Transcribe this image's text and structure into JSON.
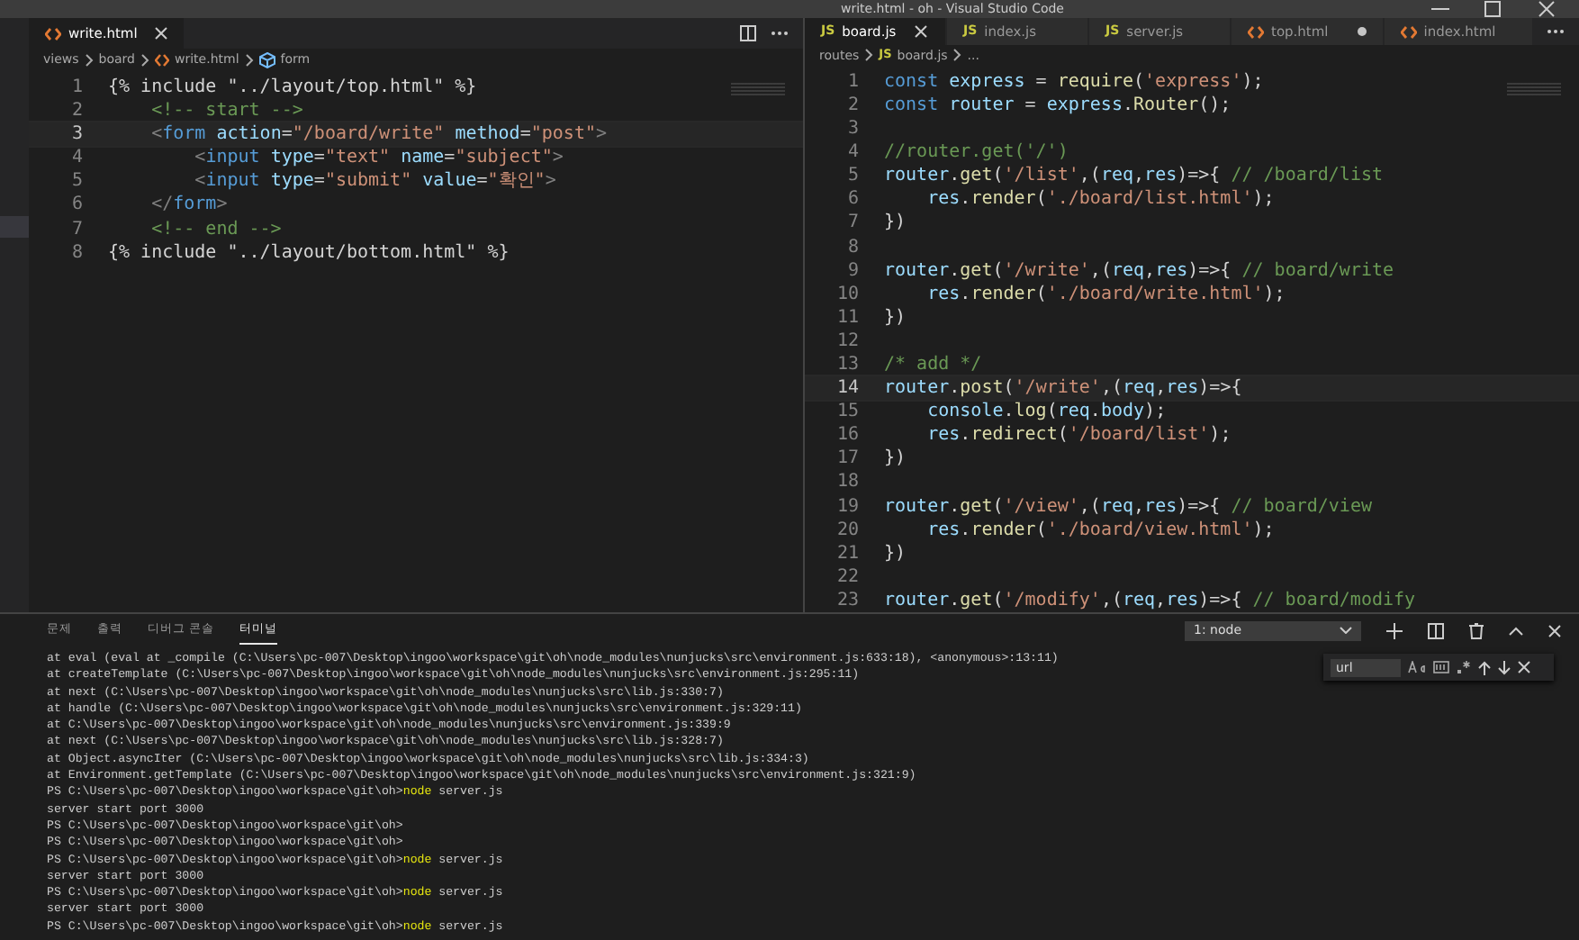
{
  "window": {
    "title": "write.html - oh - Visual Studio Code"
  },
  "left_editor": {
    "tabs": [
      {
        "label": "write.html",
        "kind": "markup",
        "selected": true,
        "modified": false
      }
    ],
    "breadcrumbs": [
      {
        "label": "views",
        "kind": "folder"
      },
      {
        "label": "board",
        "kind": "folder"
      },
      {
        "label": "write.html",
        "kind": "markup"
      },
      {
        "label": "form",
        "kind": "element"
      }
    ],
    "lines": [
      {
        "number": "1",
        "current": false,
        "tokens": [
          {
            "kind": "plain",
            "text": "{% include \"../layout/top.html\" %}"
          }
        ]
      },
      {
        "number": "2",
        "current": false,
        "tokens": [
          {
            "kind": "comment",
            "text": "    <!-- start -->"
          }
        ]
      },
      {
        "number": "3",
        "current": true,
        "tokens": [
          {
            "kind": "punc",
            "text": "    <"
          },
          {
            "kind": "tag",
            "text": "form"
          },
          {
            "kind": "attr",
            "text": " action"
          },
          {
            "kind": "plain",
            "text": "="
          },
          {
            "kind": "string",
            "text": "\"/board/write\""
          },
          {
            "kind": "attr",
            "text": " method"
          },
          {
            "kind": "plain",
            "text": "="
          },
          {
            "kind": "string",
            "text": "\"post\""
          },
          {
            "kind": "punc",
            "text": ">"
          }
        ]
      },
      {
        "number": "4",
        "current": false,
        "tokens": [
          {
            "kind": "punc",
            "text": "        <"
          },
          {
            "kind": "tag",
            "text": "input"
          },
          {
            "kind": "attr",
            "text": " type"
          },
          {
            "kind": "plain",
            "text": "="
          },
          {
            "kind": "string",
            "text": "\"text\""
          },
          {
            "kind": "attr",
            "text": " name"
          },
          {
            "kind": "plain",
            "text": "="
          },
          {
            "kind": "string",
            "text": "\"subject\""
          },
          {
            "kind": "punc",
            "text": ">"
          }
        ]
      },
      {
        "number": "5",
        "current": false,
        "tokens": [
          {
            "kind": "punc",
            "text": "        <"
          },
          {
            "kind": "tag",
            "text": "input"
          },
          {
            "kind": "attr",
            "text": " type"
          },
          {
            "kind": "plain",
            "text": "="
          },
          {
            "kind": "string",
            "text": "\"submit\""
          },
          {
            "kind": "attr",
            "text": " value"
          },
          {
            "kind": "plain",
            "text": "="
          },
          {
            "kind": "string",
            "text": "\"확인\""
          },
          {
            "kind": "punc",
            "text": ">"
          }
        ]
      },
      {
        "number": "6",
        "current": false,
        "tokens": [
          {
            "kind": "punc",
            "text": "    </"
          },
          {
            "kind": "tag",
            "text": "form"
          },
          {
            "kind": "punc",
            "text": ">"
          }
        ]
      },
      {
        "number": "7",
        "current": false,
        "tokens": [
          {
            "kind": "comment",
            "text": "    <!-- end -->"
          }
        ]
      },
      {
        "number": "8",
        "current": false,
        "tokens": [
          {
            "kind": "plain",
            "text": "{% include \"../layout/bottom.html\" %}"
          }
        ]
      }
    ]
  },
  "right_editor": {
    "tabs": [
      {
        "label": "board.js",
        "kind": "script",
        "badge": "JS",
        "selected": true,
        "modified": false
      },
      {
        "label": "index.js",
        "kind": "script",
        "badge": "JS",
        "selected": false,
        "modified": false
      },
      {
        "label": "server.js",
        "kind": "script",
        "badge": "JS",
        "selected": false,
        "modified": false
      },
      {
        "label": "top.html",
        "kind": "markup",
        "selected": false,
        "modified": true
      },
      {
        "label": "index.html",
        "kind": "markup",
        "selected": false,
        "modified": false
      }
    ],
    "breadcrumbs": [
      {
        "label": "routes",
        "kind": "folder"
      },
      {
        "label": "board.js",
        "kind": "script",
        "badge": "JS"
      },
      {
        "label": "...",
        "kind": "folder"
      }
    ],
    "lines": [
      {
        "number": "1",
        "current": false,
        "tokens": [
          {
            "kind": "keyword",
            "text": "const"
          },
          {
            "kind": "var",
            "text": " express"
          },
          {
            "kind": "plain",
            "text": " = "
          },
          {
            "kind": "func",
            "text": "require"
          },
          {
            "kind": "plain",
            "text": "("
          },
          {
            "kind": "string",
            "text": "'express'"
          },
          {
            "kind": "plain",
            "text": ");"
          }
        ]
      },
      {
        "number": "2",
        "current": false,
        "tokens": [
          {
            "kind": "keyword",
            "text": "const"
          },
          {
            "kind": "var",
            "text": " router"
          },
          {
            "kind": "plain",
            "text": " = "
          },
          {
            "kind": "var",
            "text": "express"
          },
          {
            "kind": "plain",
            "text": "."
          },
          {
            "kind": "func",
            "text": "Router"
          },
          {
            "kind": "plain",
            "text": "();"
          }
        ]
      },
      {
        "number": "3",
        "current": false
      },
      {
        "number": "4",
        "current": false,
        "tokens": [
          {
            "kind": "comment",
            "text": "//router.get('/')"
          }
        ]
      },
      {
        "number": "5",
        "current": false,
        "tokens": [
          {
            "kind": "var",
            "text": "router"
          },
          {
            "kind": "plain",
            "text": "."
          },
          {
            "kind": "func",
            "text": "get"
          },
          {
            "kind": "plain",
            "text": "("
          },
          {
            "kind": "string",
            "text": "'/list'"
          },
          {
            "kind": "plain",
            "text": ",("
          },
          {
            "kind": "var",
            "text": "req"
          },
          {
            "kind": "plain",
            "text": ","
          },
          {
            "kind": "var",
            "text": "res"
          },
          {
            "kind": "plain",
            "text": ")=>{ "
          },
          {
            "kind": "comment",
            "text": "// /board/list"
          }
        ]
      },
      {
        "number": "6",
        "current": false,
        "tokens": [
          {
            "kind": "var",
            "text": "    res"
          },
          {
            "kind": "plain",
            "text": "."
          },
          {
            "kind": "func",
            "text": "render"
          },
          {
            "kind": "plain",
            "text": "("
          },
          {
            "kind": "string",
            "text": "'./board/list.html'"
          },
          {
            "kind": "plain",
            "text": ");"
          }
        ]
      },
      {
        "number": "7",
        "current": false,
        "tokens": [
          {
            "kind": "plain",
            "text": "})"
          }
        ]
      },
      {
        "number": "8",
        "current": false
      },
      {
        "number": "9",
        "current": false,
        "tokens": [
          {
            "kind": "var",
            "text": "router"
          },
          {
            "kind": "plain",
            "text": "."
          },
          {
            "kind": "func",
            "text": "get"
          },
          {
            "kind": "plain",
            "text": "("
          },
          {
            "kind": "string",
            "text": "'/write'"
          },
          {
            "kind": "plain",
            "text": ",("
          },
          {
            "kind": "var",
            "text": "req"
          },
          {
            "kind": "plain",
            "text": ","
          },
          {
            "kind": "var",
            "text": "res"
          },
          {
            "kind": "plain",
            "text": ")=>{ "
          },
          {
            "kind": "comment",
            "text": "// board/write"
          }
        ]
      },
      {
        "number": "10",
        "current": false,
        "tokens": [
          {
            "kind": "var",
            "text": "    res"
          },
          {
            "kind": "plain",
            "text": "."
          },
          {
            "kind": "func",
            "text": "render"
          },
          {
            "kind": "plain",
            "text": "("
          },
          {
            "kind": "string",
            "text": "'./board/write.html'"
          },
          {
            "kind": "plain",
            "text": ");"
          }
        ]
      },
      {
        "number": "11",
        "current": false,
        "tokens": [
          {
            "kind": "plain",
            "text": "})"
          }
        ]
      },
      {
        "number": "12",
        "current": false
      },
      {
        "number": "13",
        "current": false,
        "tokens": [
          {
            "kind": "comment",
            "text": "/* add */"
          }
        ]
      },
      {
        "number": "14",
        "current": true,
        "tokens": [
          {
            "kind": "var",
            "text": "router"
          },
          {
            "kind": "plain",
            "text": "."
          },
          {
            "kind": "func",
            "text": "post"
          },
          {
            "kind": "plain",
            "text": "("
          },
          {
            "kind": "string",
            "text": "'/write'"
          },
          {
            "kind": "plain",
            "text": ",("
          },
          {
            "kind": "var",
            "text": "req"
          },
          {
            "kind": "plain",
            "text": ","
          },
          {
            "kind": "var",
            "text": "res"
          },
          {
            "kind": "plain",
            "text": ")=>{"
          }
        ]
      },
      {
        "number": "15",
        "current": false,
        "tokens": [
          {
            "kind": "var",
            "text": "    console"
          },
          {
            "kind": "plain",
            "text": "."
          },
          {
            "kind": "func",
            "text": "log"
          },
          {
            "kind": "plain",
            "text": "("
          },
          {
            "kind": "var",
            "text": "req"
          },
          {
            "kind": "plain",
            "text": "."
          },
          {
            "kind": "var",
            "text": "body"
          },
          {
            "kind": "plain",
            "text": ");"
          }
        ]
      },
      {
        "number": "16",
        "current": false,
        "tokens": [
          {
            "kind": "var",
            "text": "    res"
          },
          {
            "kind": "plain",
            "text": "."
          },
          {
            "kind": "func",
            "text": "redirect"
          },
          {
            "kind": "plain",
            "text": "("
          },
          {
            "kind": "string",
            "text": "'/board/list'"
          },
          {
            "kind": "plain",
            "text": ");"
          }
        ]
      },
      {
        "number": "17",
        "current": false,
        "tokens": [
          {
            "kind": "plain",
            "text": "})"
          }
        ]
      },
      {
        "number": "18",
        "current": false
      },
      {
        "number": "19",
        "current": false,
        "tokens": [
          {
            "kind": "var",
            "text": "router"
          },
          {
            "kind": "plain",
            "text": "."
          },
          {
            "kind": "func",
            "text": "get"
          },
          {
            "kind": "plain",
            "text": "("
          },
          {
            "kind": "string",
            "text": "'/view'"
          },
          {
            "kind": "plain",
            "text": ",("
          },
          {
            "kind": "var",
            "text": "req"
          },
          {
            "kind": "plain",
            "text": ","
          },
          {
            "kind": "var",
            "text": "res"
          },
          {
            "kind": "plain",
            "text": ")=>{ "
          },
          {
            "kind": "comment",
            "text": "// board/view"
          }
        ]
      },
      {
        "number": "20",
        "current": false,
        "tokens": [
          {
            "kind": "var",
            "text": "    res"
          },
          {
            "kind": "plain",
            "text": "."
          },
          {
            "kind": "func",
            "text": "render"
          },
          {
            "kind": "plain",
            "text": "("
          },
          {
            "kind": "string",
            "text": "'./board/view.html'"
          },
          {
            "kind": "plain",
            "text": ");"
          }
        ]
      },
      {
        "number": "21",
        "current": false,
        "tokens": [
          {
            "kind": "plain",
            "text": "})"
          }
        ]
      },
      {
        "number": "22",
        "current": false
      },
      {
        "number": "23",
        "current": false,
        "tokens": [
          {
            "kind": "var",
            "text": "router"
          },
          {
            "kind": "plain",
            "text": "."
          },
          {
            "kind": "func",
            "text": "get"
          },
          {
            "kind": "plain",
            "text": "("
          },
          {
            "kind": "string",
            "text": "'/modify'"
          },
          {
            "kind": "plain",
            "text": ",("
          },
          {
            "kind": "var",
            "text": "req"
          },
          {
            "kind": "plain",
            "text": ","
          },
          {
            "kind": "var",
            "text": "res"
          },
          {
            "kind": "plain",
            "text": ")=>{ "
          },
          {
            "kind": "comment",
            "text": "// board/modify"
          }
        ]
      }
    ]
  },
  "panel": {
    "tabs": [
      {
        "label": "문제",
        "selected": false
      },
      {
        "label": "출력",
        "selected": false
      },
      {
        "label": "디버그 콘솔",
        "selected": false
      },
      {
        "label": "터미널",
        "selected": true
      }
    ],
    "terminal_select": {
      "value": "1: node"
    },
    "find": {
      "value": "url"
    },
    "terminal_lines": [
      {
        "kind": "trace",
        "text": "at eval (eval at _compile (C:\\Users\\pc-007\\Desktop\\ingoo\\workspace\\git\\oh\\node_modules\\nunjucks\\src\\environment.js:633:18), <anonymous>:13:11)"
      },
      {
        "kind": "trace",
        "text": "at createTemplate (C:\\Users\\pc-007\\Desktop\\ingoo\\workspace\\git\\oh\\node_modules\\nunjucks\\src\\environment.js:295:11)"
      },
      {
        "kind": "trace",
        "text": "at next (C:\\Users\\pc-007\\Desktop\\ingoo\\workspace\\git\\oh\\node_modules\\nunjucks\\src\\lib.js:330:7)"
      },
      {
        "kind": "trace",
        "text": "at handle (C:\\Users\\pc-007\\Desktop\\ingoo\\workspace\\git\\oh\\node_modules\\nunjucks\\src\\environment.js:329:11)"
      },
      {
        "kind": "trace",
        "text": "at C:\\Users\\pc-007\\Desktop\\ingoo\\workspace\\git\\oh\\node_modules\\nunjucks\\src\\environment.js:339:9"
      },
      {
        "kind": "trace",
        "text": "at next (C:\\Users\\pc-007\\Desktop\\ingoo\\workspace\\git\\oh\\node_modules\\nunjucks\\src\\lib.js:328:7)"
      },
      {
        "kind": "trace",
        "text": "at Object.asyncIter (C:\\Users\\pc-007\\Desktop\\ingoo\\workspace\\git\\oh\\node_modules\\nunjucks\\src\\lib.js:334:3)"
      },
      {
        "kind": "trace",
        "text": "at Environment.getTemplate (C:\\Users\\pc-007\\Desktop\\ingoo\\workspace\\git\\oh\\node_modules\\nunjucks\\src\\environment.js:321:9)"
      },
      {
        "kind": "prompt",
        "text": "PS C:\\Users\\pc-007\\Desktop\\ingoo\\workspace\\git\\oh>",
        "command": "node",
        "args": "server.js"
      },
      {
        "kind": "output",
        "text": "server start port 3000"
      },
      {
        "kind": "prompt",
        "text": "PS C:\\Users\\pc-007\\Desktop\\ingoo\\workspace\\git\\oh>"
      },
      {
        "kind": "prompt",
        "text": "PS C:\\Users\\pc-007\\Desktop\\ingoo\\workspace\\git\\oh>"
      },
      {
        "kind": "prompt",
        "text": "PS C:\\Users\\pc-007\\Desktop\\ingoo\\workspace\\git\\oh>",
        "command": "node",
        "args": "server.js"
      },
      {
        "kind": "output",
        "text": "server start port 3000"
      },
      {
        "kind": "prompt",
        "text": "PS C:\\Users\\pc-007\\Desktop\\ingoo\\workspace\\git\\oh>",
        "command": "node",
        "args": "server.js"
      },
      {
        "kind": "output",
        "text": "server start port 3000"
      },
      {
        "kind": "prompt",
        "text": "PS C:\\Users\\pc-007\\Desktop\\ingoo\\workspace\\git\\oh>",
        "command": "node",
        "args": "server.js"
      }
    ]
  }
}
